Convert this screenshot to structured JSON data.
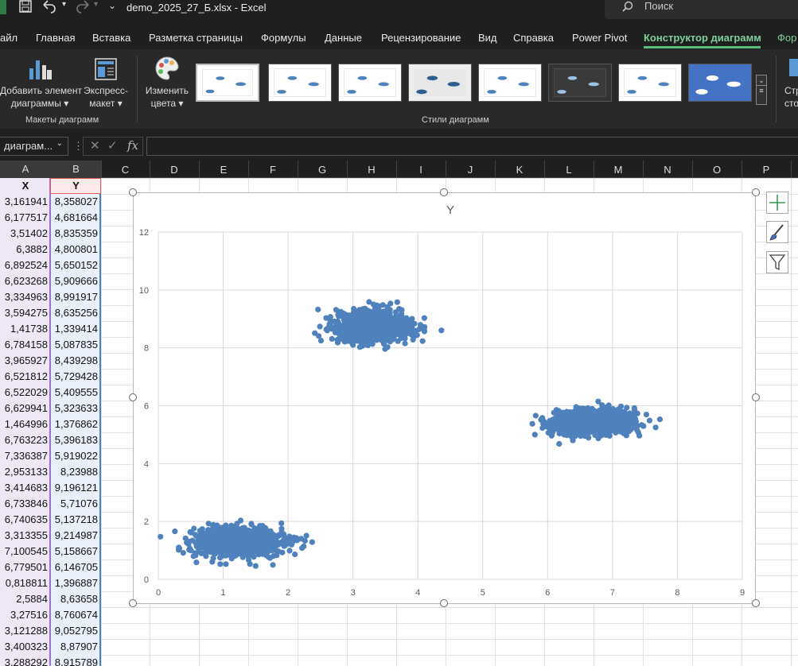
{
  "titlebar": {
    "doc_title": "demo_2025_27_Б.xlsx  -  Excel",
    "search_placeholder": "Поиск"
  },
  "tabs": [
    {
      "label": "айл"
    },
    {
      "label": "Главная"
    },
    {
      "label": "Вставка"
    },
    {
      "label": "Разметка страницы"
    },
    {
      "label": "Формулы"
    },
    {
      "label": "Данные"
    },
    {
      "label": "Рецензирование"
    },
    {
      "label": "Вид"
    },
    {
      "label": "Справка"
    },
    {
      "label": "Power Pivot"
    },
    {
      "label": "Конструктор диаграмм",
      "active": true
    },
    {
      "label": "Фор"
    }
  ],
  "ribbon": {
    "add_element": {
      "line1": "Добавить элемент",
      "line2": "диаграммы ▾"
    },
    "express_layout": {
      "line1": "Экспресс-",
      "line2": "макет ▾"
    },
    "change_colors": {
      "line1": "Изменить",
      "line2": "цвета ▾"
    },
    "group_layouts": "Макеты диаграмм",
    "group_styles": "Стили диаграмм",
    "cut_label": {
      "line1": "Стр",
      "line2": "сто"
    }
  },
  "formula_bar": {
    "name_box": "диаграм...",
    "fx_label": "fx",
    "formula": ""
  },
  "columns": [
    "A",
    "B",
    "C",
    "D",
    "E",
    "F",
    "G",
    "H",
    "I",
    "J",
    "K",
    "L",
    "M",
    "N",
    "O",
    "P"
  ],
  "table": {
    "headers": [
      "X",
      "Y"
    ],
    "rows": [
      [
        "3,161941",
        "8,358027"
      ],
      [
        "6,177517",
        "4,681664"
      ],
      [
        "3,51402",
        "8,835359"
      ],
      [
        "6,3882",
        "4,800801"
      ],
      [
        "6,892524",
        "5,650152"
      ],
      [
        "6,623268",
        "5,909666"
      ],
      [
        "3,334963",
        "8,991917"
      ],
      [
        "3,594275",
        "8,635256"
      ],
      [
        "1,41738",
        "1,339414"
      ],
      [
        "6,784158",
        "5,087835"
      ],
      [
        "3,965927",
        "8,439298"
      ],
      [
        "6,521812",
        "5,729428"
      ],
      [
        "6,522029",
        "5,409555"
      ],
      [
        "6,629941",
        "5,323633"
      ],
      [
        "1,464996",
        "1,376862"
      ],
      [
        "6,763223",
        "5,396183"
      ],
      [
        "7,336387",
        "5,919022"
      ],
      [
        "2,953133",
        "8,23988"
      ],
      [
        "3,414683",
        "9,196121"
      ],
      [
        "6,733846",
        "5,71076"
      ],
      [
        "6,740635",
        "5,137218"
      ],
      [
        "3,313355",
        "9,214987"
      ],
      [
        "7,100545",
        "5,158667"
      ],
      [
        "6,779501",
        "6,146705"
      ],
      [
        "0,818811",
        "1,396887"
      ],
      [
        "2,5884",
        "8,63658"
      ],
      [
        "3,27516",
        "8,760674"
      ],
      [
        "3,121288",
        "9,052795"
      ],
      [
        "3,400323",
        "8,87907"
      ],
      [
        "3,288292",
        "8,915789"
      ]
    ]
  },
  "colors": {
    "accent": "#7fd09b",
    "series": "#4f81bd"
  },
  "chart_data": {
    "type": "scatter",
    "title": "Y",
    "xlabel": "",
    "ylabel": "",
    "xlim": [
      0,
      9
    ],
    "ylim": [
      0,
      12
    ],
    "xticks": [
      0,
      1,
      2,
      3,
      4,
      5,
      6,
      7,
      8,
      9
    ],
    "yticks": [
      0,
      2,
      4,
      6,
      8,
      10,
      12
    ],
    "grid": true,
    "legend": "none",
    "series": [
      {
        "clusters": [
          {
            "center": [
              1.25,
              1.3
            ],
            "spread": [
              0.35,
              0.25
            ],
            "approx_points": 900
          },
          {
            "center": [
              3.3,
              8.75
            ],
            "spread": [
              0.3,
              0.25
            ],
            "approx_points": 900
          },
          {
            "center": [
              6.7,
              5.45
            ],
            "spread": [
              0.32,
              0.2
            ],
            "approx_points": 900
          }
        ],
        "points": [
          [
            3.161941,
            8.358027
          ],
          [
            6.177517,
            4.681664
          ],
          [
            3.51402,
            8.835359
          ],
          [
            6.3882,
            4.800801
          ],
          [
            6.892524,
            5.650152
          ],
          [
            6.623268,
            5.909666
          ],
          [
            3.334963,
            8.991917
          ],
          [
            3.594275,
            8.635256
          ],
          [
            1.41738,
            1.339414
          ],
          [
            6.784158,
            5.087835
          ],
          [
            3.965927,
            8.439298
          ],
          [
            6.521812,
            5.729428
          ],
          [
            6.522029,
            5.409555
          ],
          [
            6.629941,
            5.323633
          ],
          [
            1.464996,
            1.376862
          ],
          [
            6.763223,
            5.396183
          ],
          [
            7.336387,
            5.919022
          ],
          [
            2.953133,
            8.23988
          ],
          [
            3.414683,
            9.196121
          ],
          [
            6.733846,
            5.71076
          ],
          [
            6.740635,
            5.137218
          ],
          [
            3.313355,
            9.214987
          ],
          [
            7.100545,
            5.158667
          ],
          [
            6.779501,
            6.146705
          ],
          [
            0.818811,
            1.396887
          ],
          [
            2.5884,
            8.63658
          ],
          [
            3.27516,
            8.760674
          ],
          [
            3.121288,
            9.052795
          ],
          [
            3.400323,
            8.87907
          ],
          [
            3.288292,
            8.915789
          ]
        ]
      }
    ]
  }
}
